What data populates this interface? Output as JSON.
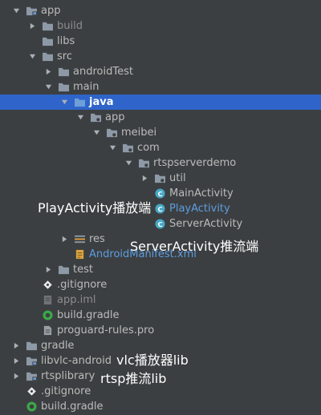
{
  "colors": {
    "background": "#3c3f41",
    "selection": "#2f65ca",
    "text": "#bbbbbb",
    "folder": "#8d99a6",
    "folder_blue": "#6d9fd8",
    "class_badge": "#47a8c6",
    "gradle": "#3ba849",
    "git": "#e8e8e8"
  },
  "tree": {
    "items": [
      {
        "label": "app",
        "arrow": "down",
        "icon": "module-folder-icon"
      },
      {
        "label": "build",
        "arrow": "right",
        "icon": "folder-icon",
        "style": "dim"
      },
      {
        "label": "libs",
        "arrow": "none",
        "icon": "folder-icon"
      },
      {
        "label": "src",
        "arrow": "down",
        "icon": "folder-icon"
      },
      {
        "label": "androidTest",
        "arrow": "right",
        "icon": "folder-icon"
      },
      {
        "label": "main",
        "arrow": "down",
        "icon": "folder-icon"
      },
      {
        "label": "java",
        "arrow": "down",
        "icon": "source-folder-icon",
        "selected": true
      },
      {
        "label": "app",
        "arrow": "down",
        "icon": "package-icon"
      },
      {
        "label": "meibei",
        "arrow": "down",
        "icon": "package-icon"
      },
      {
        "label": "com",
        "arrow": "down",
        "icon": "package-icon"
      },
      {
        "label": "rtspserverdemo",
        "arrow": "down",
        "icon": "package-icon"
      },
      {
        "label": "util",
        "arrow": "right",
        "icon": "package-icon"
      },
      {
        "label": "MainActivity",
        "arrow": "none",
        "icon": "class-icon"
      },
      {
        "label": "PlayActivity",
        "arrow": "none",
        "icon": "class-icon",
        "style": "blue"
      },
      {
        "label": "ServerActivity",
        "arrow": "none",
        "icon": "class-icon"
      },
      {
        "label": "res",
        "arrow": "right",
        "icon": "resource-folder-icon"
      },
      {
        "label": "AndroidManifest.xml",
        "arrow": "none",
        "icon": "manifest-icon",
        "style": "blue"
      },
      {
        "label": "test",
        "arrow": "right",
        "icon": "folder-icon"
      },
      {
        "label": ".gitignore",
        "arrow": "none",
        "icon": "git-icon"
      },
      {
        "label": "app.iml",
        "arrow": "none",
        "icon": "iml-icon",
        "style": "dim"
      },
      {
        "label": "build.gradle",
        "arrow": "none",
        "icon": "gradle-icon"
      },
      {
        "label": "proguard-rules.pro",
        "arrow": "none",
        "icon": "file-icon"
      },
      {
        "label": "gradle",
        "arrow": "right",
        "icon": "folder-icon"
      },
      {
        "label": "libvlc-android",
        "arrow": "right",
        "icon": "module-folder-icon"
      },
      {
        "label": "rtsplibrary",
        "arrow": "right",
        "icon": "module-folder-icon"
      },
      {
        "label": ".gitignore",
        "arrow": "none",
        "icon": "git-icon"
      },
      {
        "label": "build.gradle",
        "arrow": "none",
        "icon": "gradle-icon"
      }
    ]
  },
  "annotations": {
    "play_activity": "PlayActivity播放端",
    "server_activity": "ServerActivity推流端",
    "vlc_lib": "vlc播放器lib",
    "rtsp_lib": "rtsp推流lib"
  }
}
